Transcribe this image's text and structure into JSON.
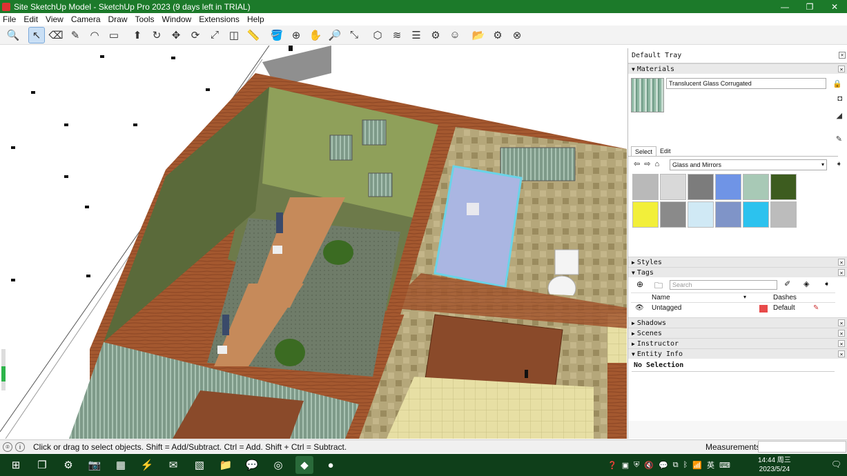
{
  "window": {
    "title": "Site SketchUp Model - SketchUp Pro 2023 (9 days left in TRIAL)",
    "minimize": "—",
    "maximize": "❐",
    "close": "✕"
  },
  "menu": [
    "File",
    "Edit",
    "View",
    "Camera",
    "Draw",
    "Tools",
    "Window",
    "Extensions",
    "Help"
  ],
  "toolbar": {
    "icons": [
      "zoom-window-icon",
      "select-icon",
      "eraser-icon",
      "line-icon",
      "arc-icon",
      "shape-icon",
      "push-pull-icon",
      "follow-me-icon",
      "move-icon",
      "rotate-icon",
      "scale-icon",
      "offset-icon",
      "tape-icon",
      "paint-icon",
      "orbit-icon",
      "pan-icon",
      "zoom-icon",
      "zoom-extents-icon",
      "section-plane-icon",
      "styles-icon",
      "warehouse-icon",
      "extension-icon",
      "profile-icon",
      "open-icon",
      "settings-icon",
      "close-circle-icon"
    ],
    "glyphs": [
      "🔍",
      "↖",
      "⌫",
      "✎",
      "◠",
      "▭",
      "⬆",
      "↻",
      "✥",
      "⟳",
      "⤢",
      "◫",
      "📏",
      "🪣",
      "⊕",
      "✋",
      "🔎",
      "⤡",
      "⬡",
      "≋",
      "☰",
      "⚙",
      "☺",
      "📂",
      "⚙",
      "⊗"
    ]
  },
  "tray": {
    "title": "Default Tray",
    "materials": {
      "header": "Materials",
      "current_name": "Translucent Glass Corrugated",
      "tab_select": "Select",
      "tab_edit": "Edit",
      "library": "Glass and Mirrors",
      "swatch_colors": [
        "#b9b9b9",
        "#d9d9d9",
        "#7c7c7c",
        "#6f94e6",
        "#a8c9b6",
        "#3d5c1f",
        "#f2ef3a",
        "#8a8a8a",
        "#d0e9f5",
        "#7f94c8",
        "#2cc2ee",
        "#bcbcbc"
      ]
    },
    "styles": {
      "header": "Styles"
    },
    "tags": {
      "header": "Tags",
      "search_placeholder": "Search",
      "col_name": "Name",
      "col_dashes": "Dashes",
      "row_name": "Untagged",
      "row_dashes": "Default",
      "row_color": "#e84a4a"
    },
    "shadows": {
      "header": "Shadows"
    },
    "scenes": {
      "header": "Scenes"
    },
    "instructor": {
      "header": "Instructor"
    },
    "entity_info": {
      "header": "Entity Info",
      "selection": "No Selection"
    }
  },
  "status": {
    "text": "Click or drag to select objects. Shift = Add/Subtract. Ctrl = Add. Shift + Ctrl = Subtract.",
    "measurements_label": "Measurements"
  },
  "taskbar": {
    "apps": [
      "windows-start-icon",
      "task-view-icon",
      "settings-icon",
      "camera-icon",
      "app-icon",
      "app-icon-2",
      "outlook-icon",
      "app-icon-3",
      "file-explorer-icon",
      "wechat-icon",
      "edge-icon",
      "sketchup-icon",
      "powerpoint-icon"
    ],
    "time": "14:44 周三",
    "date": "2023/5/24",
    "ime": "英"
  }
}
